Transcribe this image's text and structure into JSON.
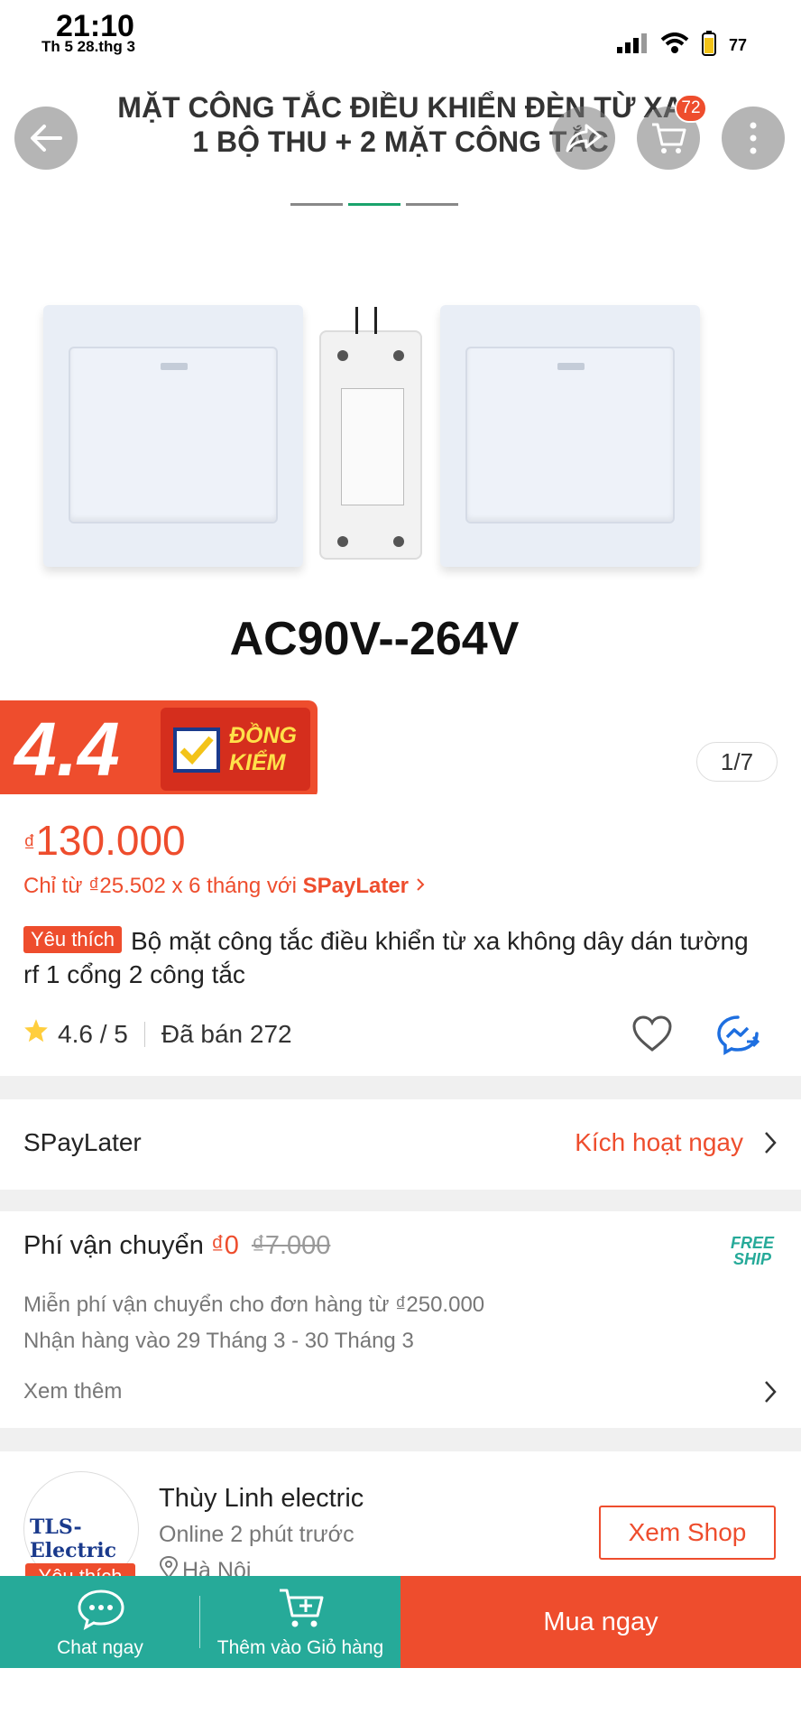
{
  "status_bar": {
    "time": "21:10",
    "date": "Th 5 28.thg 3",
    "battery": "77"
  },
  "gallery": {
    "banner_line1": "MẶT CÔNG TẮC ĐIỀU KHIỂN ĐÈN TỪ XA",
    "banner_line2": "1 BỘ THU + 2 MẶT CÔNG TẮC",
    "voltage_text": "AC90V--264V",
    "cart_count": "72",
    "page_indicator": "1/7",
    "rating_badge": "4.4",
    "dong_kiem_line1": "ĐỒNG",
    "dong_kiem_line2": "KIỂM"
  },
  "product": {
    "price_currency": "₫",
    "price": "130.000",
    "installment_prefix": "Chỉ từ ₫25.502 x 6 tháng với ",
    "installment_brand": "SPayLater",
    "favorite_tag": "Yêu thích",
    "title": "Bộ mặt công tắc điều khiển từ xa không dây dán tường rf 1 cổng 2 công tắc",
    "rating": "4.6 / 5",
    "sold": "Đã bán 272"
  },
  "spaylater": {
    "label": "SPayLater",
    "action": "Kích hoạt ngay"
  },
  "shipping": {
    "label": "Phí vận chuyển",
    "fee": "₫0",
    "old_fee": "₫7.000",
    "freeship_line1": "FREE",
    "freeship_line2": "SHIP",
    "line1": "Miễn phí vận chuyển cho đơn hàng từ ₫250.000",
    "line2": "Nhận hàng vào 29 Tháng 3 - 30 Tháng 3",
    "more": "Xem thêm"
  },
  "shop": {
    "logo_text": "TLS-Electric",
    "favorite_tag": "Yêu thích",
    "name": "Thùy Linh electric",
    "online": "Online 2 phút trước",
    "location": "Hà Nội",
    "button": "Xem Shop"
  },
  "bottom_bar": {
    "chat": "Chat ngay",
    "add_cart": "Thêm vào Giỏ hàng",
    "buy": "Mua ngay"
  },
  "colors": {
    "brand": "#ee4d2d",
    "teal": "#26aa99"
  }
}
